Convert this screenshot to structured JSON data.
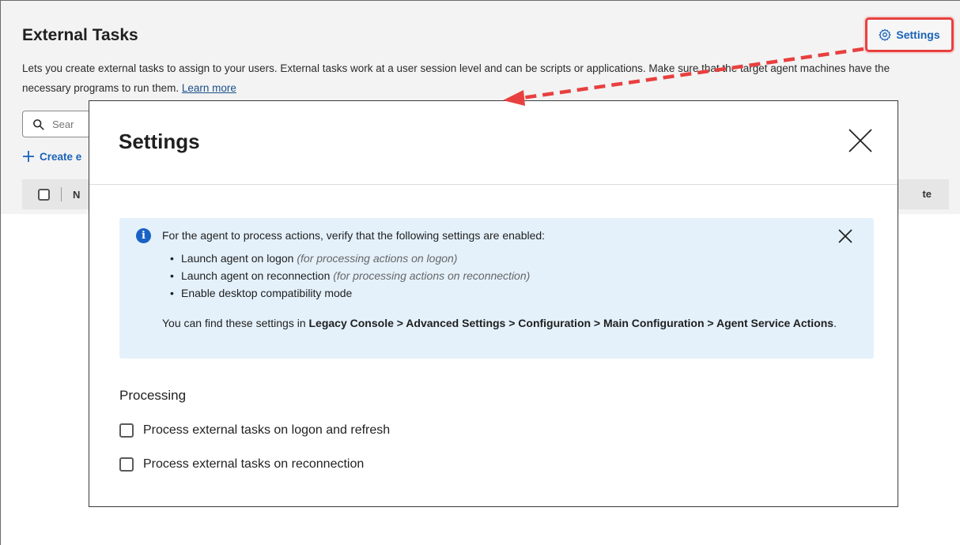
{
  "page": {
    "title": "External Tasks",
    "description": "Lets you create external tasks to assign to your users. External tasks work at a user session level and can be scripts or applications. Make sure that the target agent machines have the necessary programs to run them.",
    "learn_more": "Learn more",
    "settings_label": "Settings",
    "search_placeholder": "Sear",
    "create_label": "Create e",
    "table_header_partial": "N",
    "table_header_right": "te"
  },
  "modal": {
    "title": "Settings",
    "banner": {
      "lead": "For the agent to process actions, verify that the following settings are enabled:",
      "items": [
        {
          "text": "Launch agent on logon",
          "note": "(for processing actions on logon)"
        },
        {
          "text": "Launch agent on reconnection",
          "note": "(for processing actions on reconnection)"
        },
        {
          "text": "Enable desktop compatibility mode",
          "note": ""
        }
      ],
      "foot_prefix": "You can find these settings in ",
      "foot_path": "Legacy Console > Advanced Settings > Configuration > Main Configuration > Agent Service Actions",
      "foot_suffix": "."
    },
    "processing": {
      "heading": "Processing",
      "options": [
        {
          "label": "Process external tasks on logon and refresh",
          "checked": false
        },
        {
          "label": "Process external tasks on reconnection",
          "checked": false
        }
      ]
    }
  },
  "colors": {
    "accent": "#1a63b8",
    "highlight": "#e8403f",
    "banner_bg": "#e4f1fb",
    "info_icon": "#1962c4"
  },
  "icons": {
    "settings": "gear-icon",
    "search": "search-icon",
    "create": "plus-icon",
    "close": "close-icon",
    "info": "info-icon"
  }
}
